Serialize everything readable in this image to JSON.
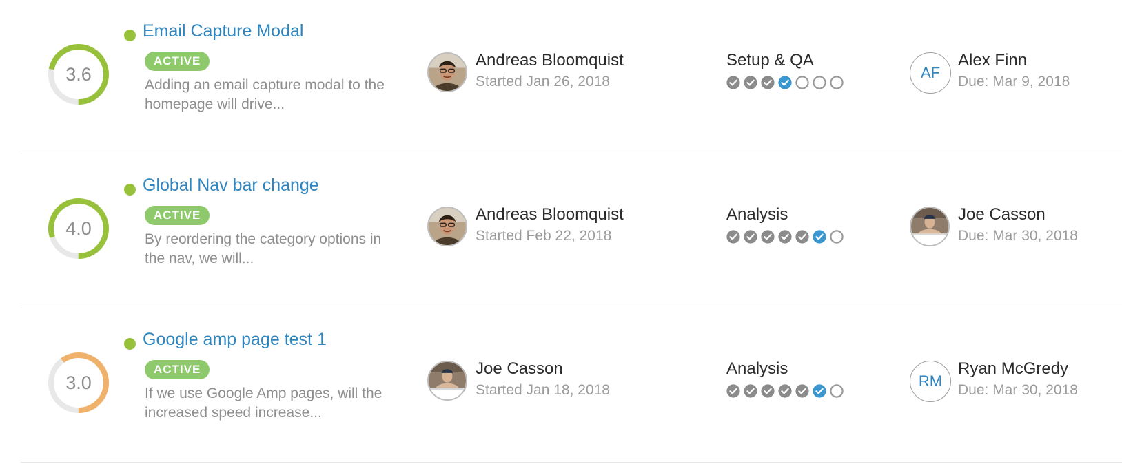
{
  "colors": {
    "ring_track": "#e8e8e8",
    "step_done": "#8b8b8b",
    "step_current": "#3b97cf",
    "step_todo": "#9a9a9a"
  },
  "experiments": [
    {
      "score": {
        "value": "3.6",
        "fraction": 0.72,
        "color": "#97c13b"
      },
      "title": "Email Capture Modal",
      "status": "ACTIVE",
      "description": "Adding an email capture modal to the homepage will drive...",
      "owner": {
        "name": "Andreas Bloomquist",
        "started": "Started Jan 26, 2018",
        "avatar": "andreas"
      },
      "stage": {
        "name": "Setup & QA",
        "steps": [
          "done",
          "done",
          "done",
          "current",
          "todo",
          "todo",
          "todo"
        ]
      },
      "assignee": {
        "name": "Alex Finn",
        "due": "Due: Mar 9, 2018",
        "initials": "AF",
        "avatar": "initials"
      }
    },
    {
      "score": {
        "value": "4.0",
        "fraction": 0.8,
        "color": "#97c13b"
      },
      "title": "Global Nav bar change",
      "status": "ACTIVE",
      "description": "By reordering the category options in the nav, we will...",
      "owner": {
        "name": "Andreas Bloomquist",
        "started": "Started Feb 22, 2018",
        "avatar": "andreas"
      },
      "stage": {
        "name": "Analysis",
        "steps": [
          "done",
          "done",
          "done",
          "done",
          "done",
          "current",
          "todo"
        ]
      },
      "assignee": {
        "name": "Joe Casson",
        "due": "Due: Mar 30, 2018",
        "initials": "",
        "avatar": "joe"
      }
    },
    {
      "score": {
        "value": "3.0",
        "fraction": 0.6,
        "color": "#f0b26b"
      },
      "title": "Google amp page test 1",
      "status": "ACTIVE",
      "description": "If we use Google Amp pages, will the increased speed increase...",
      "owner": {
        "name": "Joe Casson",
        "started": "Started Jan 18, 2018",
        "avatar": "joe"
      },
      "stage": {
        "name": "Analysis",
        "steps": [
          "done",
          "done",
          "done",
          "done",
          "done",
          "current",
          "todo"
        ]
      },
      "assignee": {
        "name": "Ryan McGredy",
        "due": "Due: Mar 30, 2018",
        "initials": "RM",
        "avatar": "initials"
      }
    }
  ]
}
